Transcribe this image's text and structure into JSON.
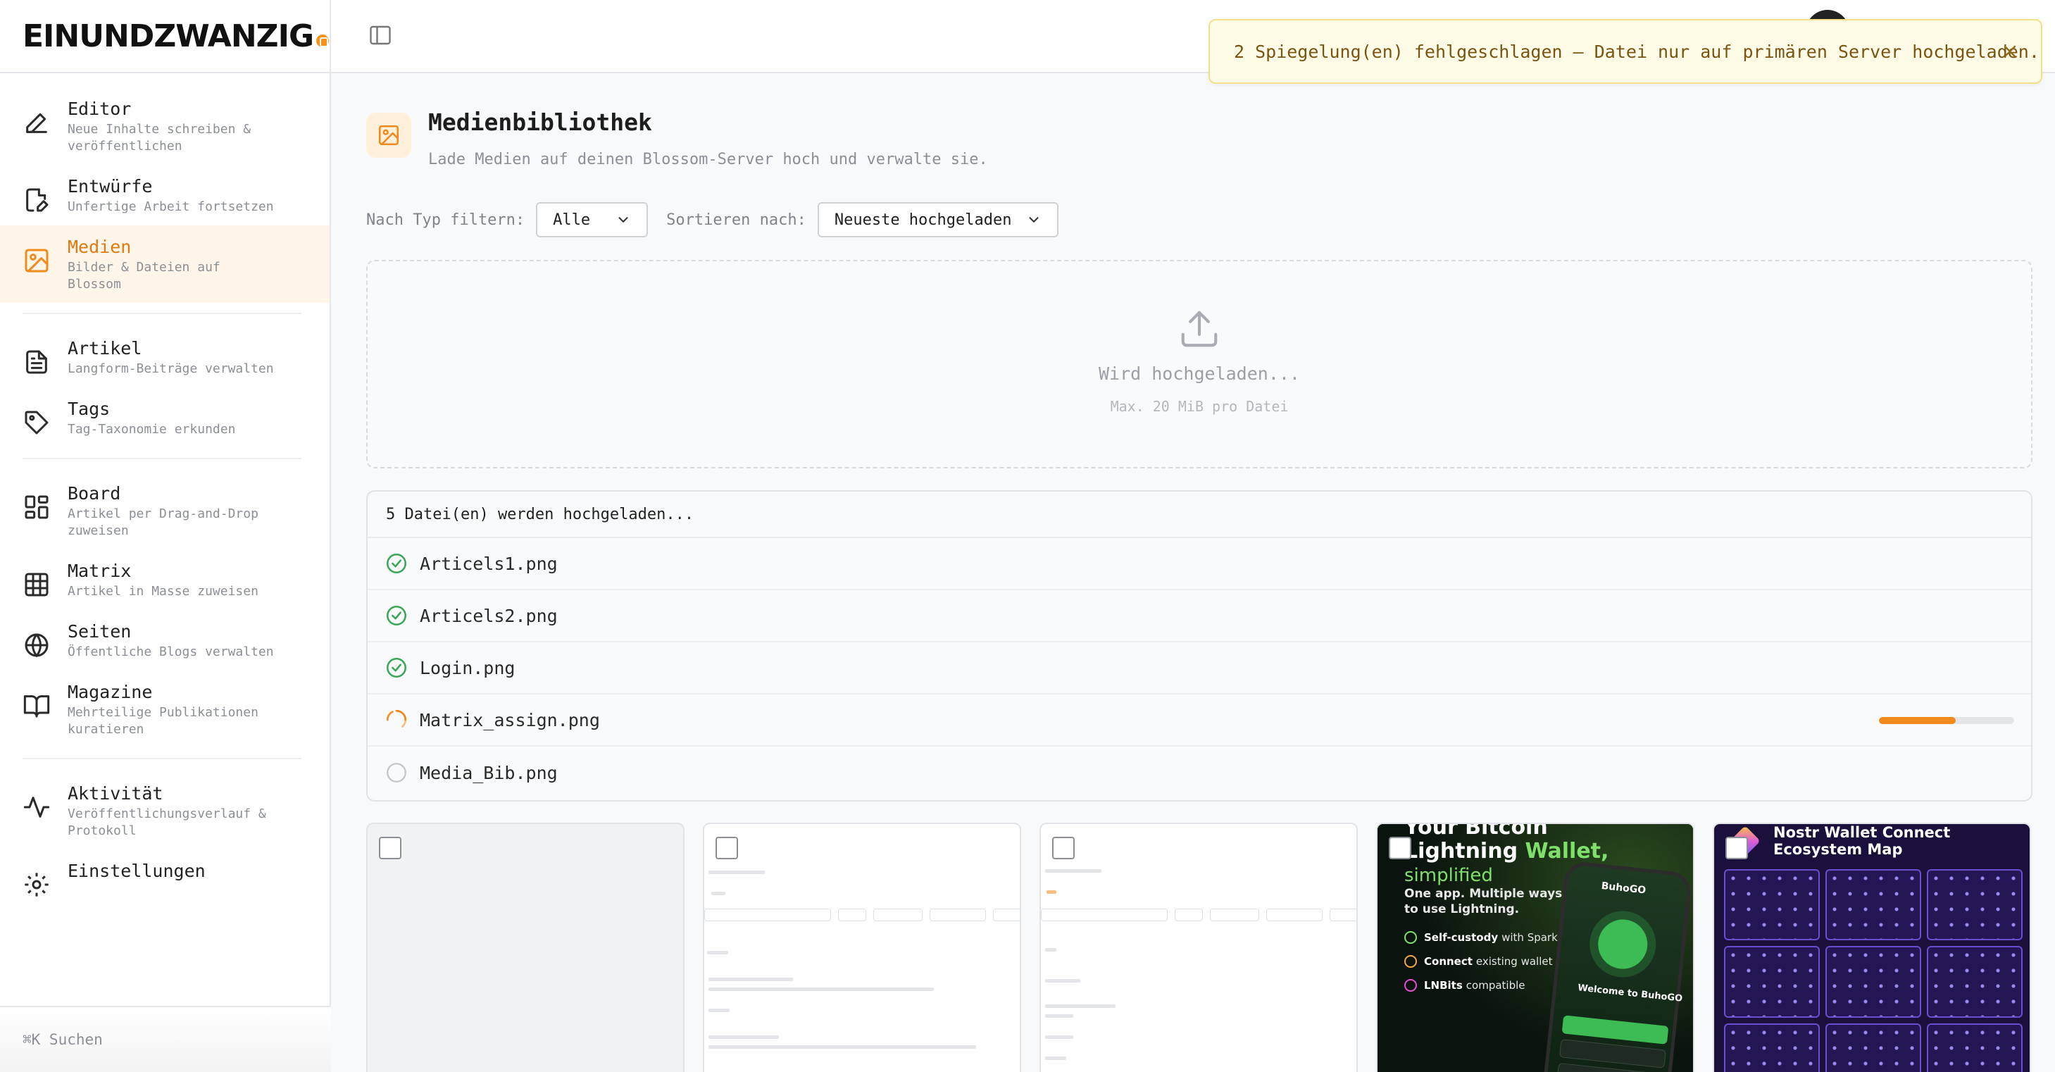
{
  "app": {
    "logo_text": "EINUNDZWANZIG",
    "brand_color": "#f08a1c"
  },
  "sidebar": {
    "items": [
      {
        "name": "editor",
        "icon": "pen-icon",
        "title": "Editor",
        "subtitle": "Neue Inhalte schreiben & veröffentlichen",
        "active": false
      },
      {
        "name": "entwuerfe",
        "icon": "draft-file-icon",
        "title": "Entwürfe",
        "subtitle": "Unfertige Arbeit fortsetzen",
        "active": false
      },
      {
        "name": "medien",
        "icon": "image-icon",
        "title": "Medien",
        "subtitle": "Bilder & Dateien auf Blossom",
        "active": true
      },
      {
        "name": "artikel",
        "icon": "document-icon",
        "title": "Artikel",
        "subtitle": "Langform-Beiträge verwalten",
        "active": false
      },
      {
        "name": "tags",
        "icon": "tag-icon",
        "title": "Tags",
        "subtitle": "Tag-Taxonomie erkunden",
        "active": false
      },
      {
        "name": "board",
        "icon": "board-icon",
        "title": "Board",
        "subtitle": "Artikel per Drag-and-Drop zuweisen",
        "active": false
      },
      {
        "name": "matrix",
        "icon": "grid-icon",
        "title": "Matrix",
        "subtitle": "Artikel in Masse zuweisen",
        "active": false
      },
      {
        "name": "seiten",
        "icon": "globe-icon",
        "title": "Seiten",
        "subtitle": "Öffentliche Blogs verwalten",
        "active": false
      },
      {
        "name": "magazine",
        "icon": "book-icon",
        "title": "Magazine",
        "subtitle": "Mehrteilige Publikationen kuratieren",
        "active": false
      },
      {
        "name": "aktivitaet",
        "icon": "activity-icon",
        "title": "Aktivität",
        "subtitle": "Veröffentlichungsverlauf & Protokoll",
        "active": false
      },
      {
        "name": "einstellungen",
        "icon": "settings-icon",
        "title": "Einstellungen",
        "subtitle": "",
        "active": false
      }
    ],
    "search_label": "⌘K Suchen"
  },
  "toast": {
    "message": "2 Spiegelung(en) fehlgeschlagen — Datei nur auf primären Server hochgeladen."
  },
  "page": {
    "title": "Medienbibliothek",
    "subtitle": "Lade Medien auf deinen Blossom-Server hoch und verwalte sie."
  },
  "filters": {
    "type_label": "Nach Typ filtern:",
    "type_value": "Alle",
    "sort_label": "Sortieren nach:",
    "sort_value": "Neueste hochgeladen"
  },
  "dropzone": {
    "title": "Wird hochgeladen...",
    "subtitle": "Max. 20 MiB pro Datei"
  },
  "uploads": {
    "header": "5 Datei(en) werden hochgeladen...",
    "files": [
      {
        "name": "Articels1.png",
        "status": "done"
      },
      {
        "name": "Articels2.png",
        "status": "done"
      },
      {
        "name": "Login.png",
        "status": "done"
      },
      {
        "name": "Matrix_assign.png",
        "status": "uploading",
        "progress": 0.57
      },
      {
        "name": "Media_Bib.png",
        "status": "pending"
      }
    ]
  },
  "media_grid": {
    "promo_buhogo": {
      "title_line1": "Your Bitcoin",
      "title_line2a": "Lightning ",
      "title_line2b": "Wallet,",
      "title_line3": "simplified",
      "subtitle_line1": "One app. Multiple ways",
      "subtitle_line2": "to use Lightning.",
      "feature1_bold": "Self-custody",
      "feature1_rest": "with Spark",
      "feature2_bold": "Connect",
      "feature2_rest": "existing wallet",
      "feature3_bold": "LNBits",
      "feature3_rest": "compatible",
      "phone_brand": "BuhoGO",
      "phone_welcome": "Welcome to BuhoGO"
    },
    "promo_nwc": {
      "title_line1": "Nostr Wallet Connect",
      "title_line2": "Ecosystem Map"
    }
  }
}
